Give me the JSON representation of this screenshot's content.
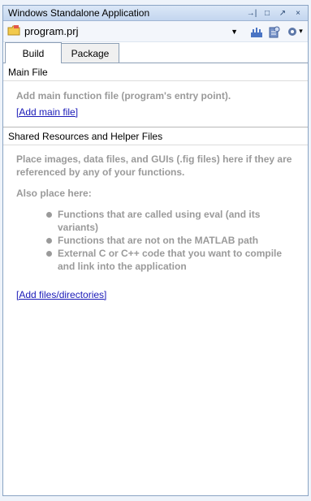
{
  "window": {
    "title": "Windows Standalone Application"
  },
  "titlebar_buttons": [
    {
      "name": "undock-icon",
      "glyph": "→|"
    },
    {
      "name": "maximize-icon",
      "glyph": "□"
    },
    {
      "name": "pin-icon",
      "glyph": "↗"
    },
    {
      "name": "close-icon",
      "glyph": "×"
    }
  ],
  "toolbar": {
    "project_name": "program.prj",
    "dropdown_glyph": "▼",
    "settings_arrow": "▾"
  },
  "tabs": [
    {
      "label": "Build",
      "active": true
    },
    {
      "label": "Package",
      "active": false
    }
  ],
  "main_file": {
    "header": "Main File",
    "hint": "Add main function file (program's entry point).",
    "link": "[Add main file]"
  },
  "shared": {
    "header": "Shared Resources and Helper Files",
    "hint": "Place images, data files, and GUIs (.fig files) here if they are referenced by any of your functions.",
    "also": "Also place here:",
    "bullets": [
      "Functions that are called using eval (and its variants)",
      "Functions that are not on the MATLAB path",
      "External C or C++ code that you want to compile and link into the application"
    ],
    "link": "[Add files/directories]"
  },
  "colors": {
    "link": "#1a1ab8",
    "hint_gray": "#9a9a9a",
    "titlebar": "#c3d6ef"
  }
}
